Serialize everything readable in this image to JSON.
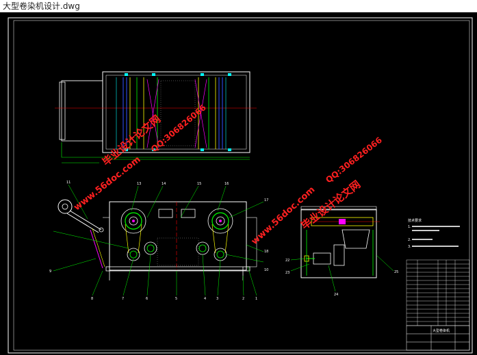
{
  "window": {
    "title": "大型卷染机设计.dwg"
  },
  "drawing": {
    "watermarks": {
      "site_top": "毕业设计论文网",
      "qq_top": "QQ:306826066",
      "url_top": "www.56doc.com",
      "site_right": "毕业设计论文网",
      "qq_right": "QQ:306826066",
      "url_right": "www.56doc.com",
      "url_left": "www.56doc.com"
    },
    "part_numbers_front": [
      "11",
      "13",
      "14",
      "15",
      "16",
      "17",
      "18",
      "10",
      "9",
      "8",
      "7",
      "6",
      "5",
      "4",
      "3",
      "2",
      "1"
    ],
    "part_numbers_side": [
      "22",
      "23",
      "24",
      "25"
    ],
    "notes_title": "技术要求",
    "notes_lines": [
      "1.",
      "2.",
      "3."
    ],
    "title_block_label": "大型卷染机"
  },
  "colors": {
    "background": "#000000",
    "frame": "#ffffff",
    "green": "#00ff00",
    "yellow": "#ffff00",
    "red": "#ff0000",
    "cyan": "#00ffff",
    "blue": "#3050ff",
    "magenta": "#ff00ff",
    "watermark": "#ff2020"
  }
}
